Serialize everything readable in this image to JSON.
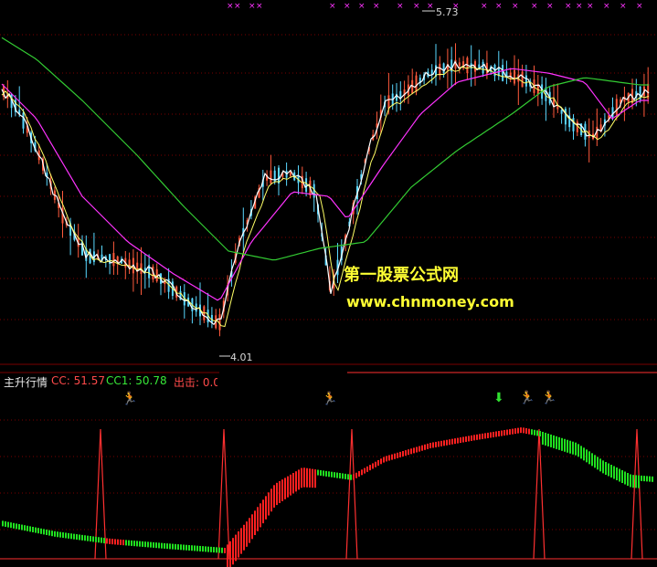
{
  "indicator": {
    "name": "主升行情",
    "cc_text": "CC: 51.57",
    "cc1_text": "CC1: 50.78",
    "out_text": "出击: 0.0"
  },
  "price_marks": {
    "high": "5.73",
    "low": "4.01"
  },
  "watermark": {
    "line1": "第一股票公式网",
    "line2": "www.chnmoney.com"
  },
  "signals": [
    {
      "glyph": "🏃",
      "color": "#f0a040",
      "icon": "runner-icon"
    },
    {
      "glyph": "🏃",
      "color": "#f0a040",
      "icon": "runner-icon"
    },
    {
      "glyph": "⬇",
      "color": "#30e030",
      "icon": "green-down-arrow-icon"
    },
    {
      "glyph": "🏃",
      "color": "#40d040",
      "icon": "runner-icon"
    },
    {
      "glyph": "🏃",
      "color": "#f0a040",
      "icon": "runner-icon"
    }
  ],
  "colors": {
    "background": "#000000",
    "grid": "#7a0000",
    "up_candle": "#ff5a3c",
    "down_candle": "#5ad8ff",
    "ma_white": "#ffffff",
    "ma_yellow": "#ffff66",
    "ma_magenta": "#ff33ff",
    "ma_green": "#33cc33",
    "histo_up": "#ff2020",
    "histo_down": "#20e020",
    "spike": "#ff3030"
  }
}
